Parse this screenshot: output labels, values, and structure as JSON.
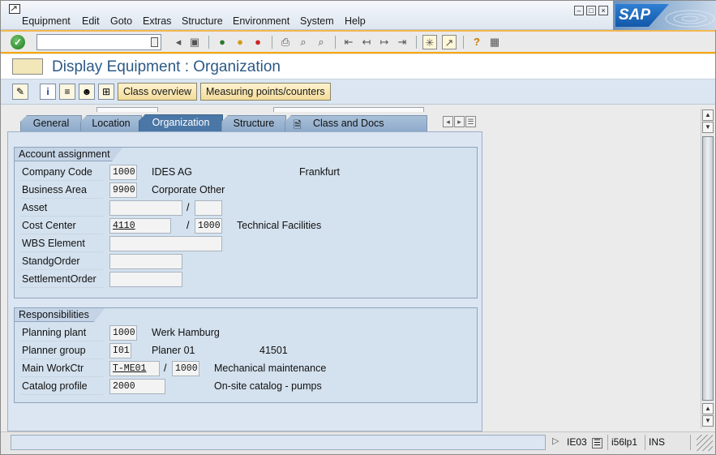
{
  "menu": [
    "Equipment",
    "Edit",
    "Goto",
    "Extras",
    "Structure",
    "Environment",
    "System",
    "Help"
  ],
  "brand": {
    "logo_text": "SAP"
  },
  "window_controls": [
    "minimize-icon",
    "maximize-icon",
    "close-icon"
  ],
  "toolbar": {
    "command_field_value": "",
    "icons": [
      "enter-icon",
      "save-icon",
      "back-icon",
      "exit-icon",
      "cancel-icon",
      "print-icon",
      "find-icon",
      "find-next-icon",
      "first-page-icon",
      "previous-page-icon",
      "next-page-icon",
      "last-page-icon",
      "create-session-icon",
      "shortcut-icon",
      "help-icon",
      "customize-layout-icon"
    ]
  },
  "title": "Display Equipment : Organization",
  "app_toolbar": {
    "icons": [
      "display-change-icon",
      "info-icon",
      "long-text-icon",
      "partner-icon",
      "structure-icon"
    ],
    "class_overview": "Class overview",
    "measuring_points": "Measuring points/counters"
  },
  "tabs": [
    {
      "label": "General",
      "active": false
    },
    {
      "label": "Location",
      "active": false
    },
    {
      "label": "Organization",
      "active": true
    },
    {
      "label": "Structure",
      "active": false
    },
    {
      "label": "Class and Docs",
      "active": false
    }
  ],
  "account_assignment": {
    "title": "Account assignment",
    "company_code": {
      "label": "Company Code",
      "value": "1000",
      "text": "IDES AG",
      "city": "Frankfurt"
    },
    "business_area": {
      "label": "Business Area",
      "value": "9900",
      "text": "Corporate Other"
    },
    "asset": {
      "label": "Asset",
      "value": "",
      "sub": ""
    },
    "cost_center": {
      "label": "Cost Center",
      "value": "4110",
      "controlling_area": "1000",
      "text": "Technical Facilities"
    },
    "wbs_element": {
      "label": "WBS Element",
      "value": ""
    },
    "standing_order": {
      "label": "StandgOrder",
      "value": ""
    },
    "settlement_order": {
      "label": "SettlementOrder",
      "value": ""
    }
  },
  "responsibilities": {
    "title": "Responsibilities",
    "planning_plant": {
      "label": "Planning plant",
      "value": "1000",
      "text": "Werk Hamburg"
    },
    "planner_group": {
      "label": "Planner group",
      "value": "I01",
      "text": "Planer 01",
      "phone": "41501"
    },
    "main_workctr": {
      "label": "Main WorkCtr",
      "value": "T-ME01",
      "plant": "1000",
      "text": "Mechanical maintenance"
    },
    "catalog_profile": {
      "label": "Catalog profile",
      "value": "2000",
      "text": "On-site catalog - pumps"
    }
  },
  "status": {
    "message": "",
    "transaction": "IE03",
    "server": "i56lp1",
    "mode": "INS"
  }
}
